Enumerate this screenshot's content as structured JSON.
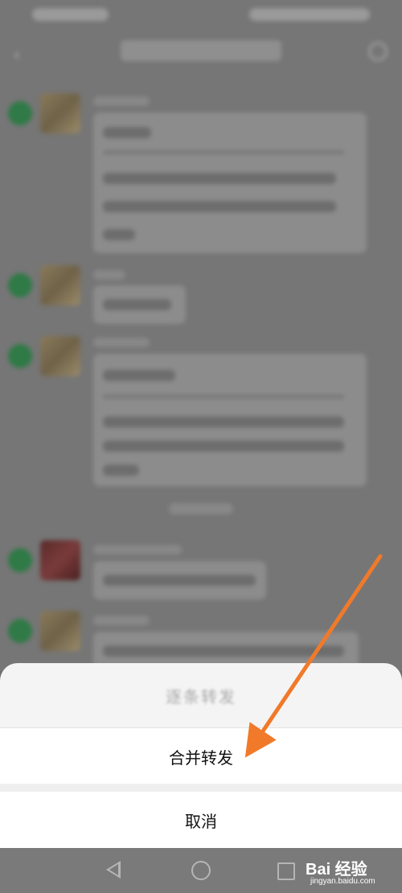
{
  "sheet": {
    "title": "逐条转发",
    "merge_forward": "合并转发",
    "cancel": "取消"
  },
  "watermark": {
    "brand": "Bai  经验",
    "url": "jingyan.baidu.com"
  },
  "colors": {
    "arrow": "#f07a2a",
    "sheet_bg": "#f4f4f4",
    "overlay": "#767676"
  }
}
